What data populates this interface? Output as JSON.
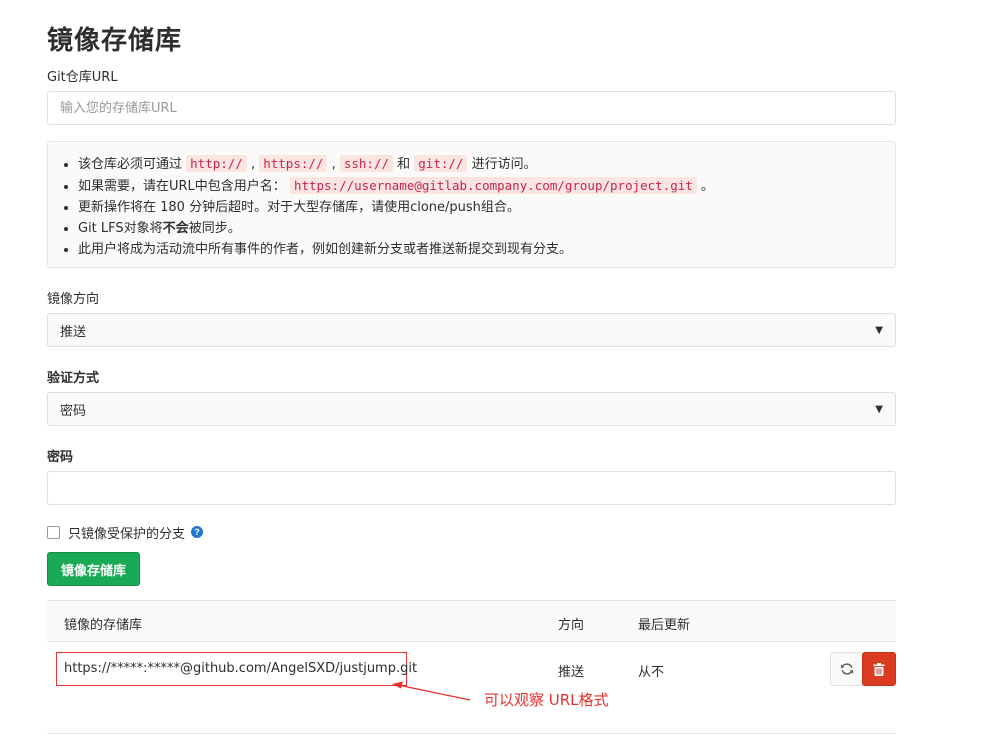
{
  "page": {
    "title": "镜像存储库"
  },
  "git_url": {
    "label": "Git仓库URL",
    "placeholder": "输入您的存储库URL",
    "value": ""
  },
  "info": {
    "line1": {
      "prefix": "该仓库必须可通过 ",
      "code1": "http://",
      "sep1": " , ",
      "code2": "https://",
      "sep2": " , ",
      "code3": "ssh://",
      "and": " 和 ",
      "code4": "git://",
      "suffix": " 进行访问。"
    },
    "line2": {
      "prefix": "如果需要，请在URL中包含用户名： ",
      "code": "https://username@gitlab.company.com/group/project.git",
      "suffix": " 。"
    },
    "line3": "更新操作将在 180 分钟后超时。对于大型存储库，请使用clone/push组合。",
    "line4": {
      "prefix": "Git LFS对象将",
      "strong": "不会",
      "suffix": "被同步。"
    },
    "line5": "此用户将成为活动流中所有事件的作者，例如创建新分支或者推送新提交到现有分支。"
  },
  "mirror_direction": {
    "label": "镜像方向",
    "selected": "推送"
  },
  "auth_method": {
    "label": "验证方式",
    "selected": "密码"
  },
  "password": {
    "label": "密码",
    "value": ""
  },
  "protected_only": {
    "label": "只镜像受保护的分支",
    "checked": false,
    "help_icon": "question-circle-icon"
  },
  "submit_button": {
    "label": "镜像存储库",
    "color": "#1aaa55"
  },
  "table": {
    "headers": {
      "repo": "镜像的存储库",
      "direction": "方向",
      "last_update": "最后更新"
    },
    "rows": [
      {
        "repo": "https://*****:*****@github.com/AngelSXD/justjump.git",
        "direction": "推送",
        "last_update": "从不",
        "actions": [
          "refresh-icon",
          "trash-icon"
        ]
      }
    ]
  },
  "annotation": {
    "text": "可以观察 URL格式",
    "color": "#e8312f"
  }
}
